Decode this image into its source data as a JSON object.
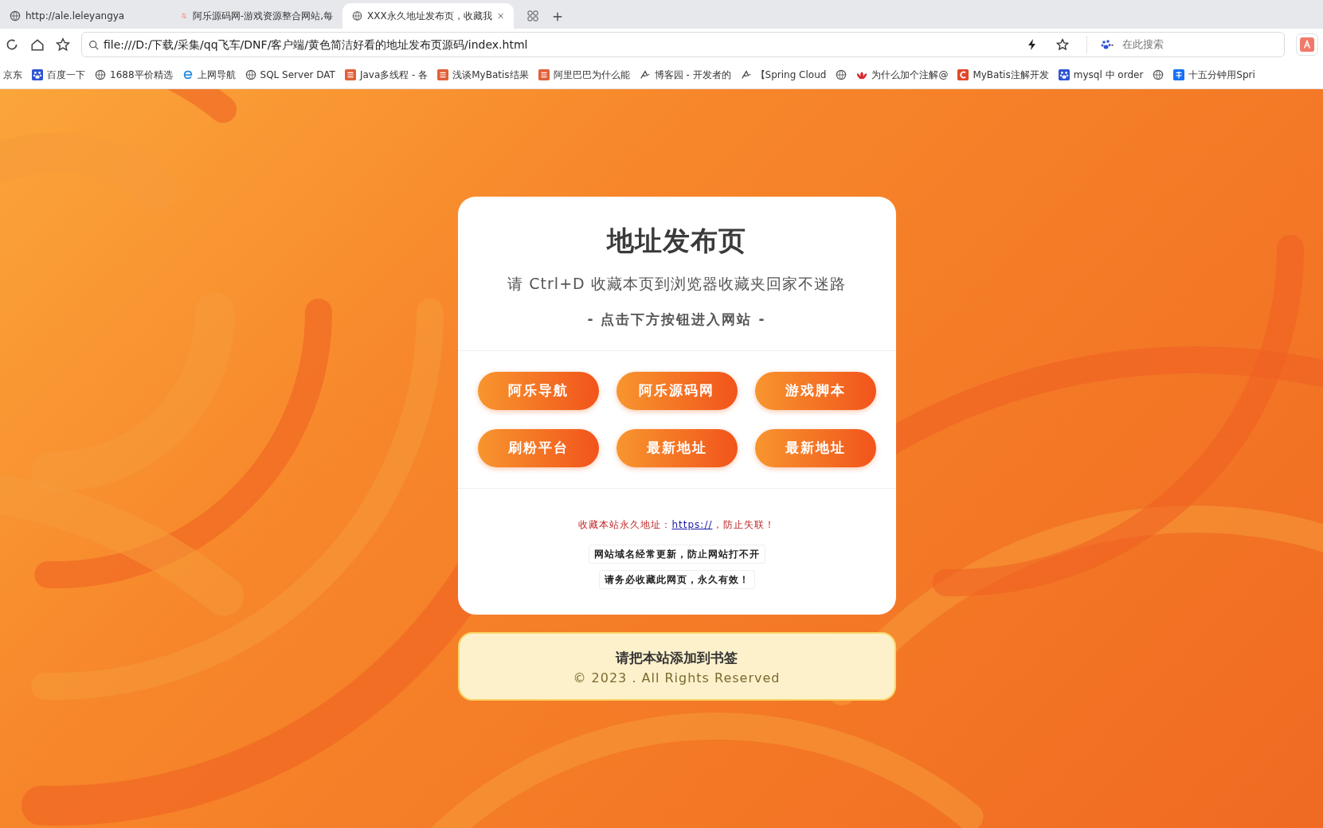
{
  "browser": {
    "tabs": [
      {
        "label": "http://ale.leleyangya",
        "selected": false,
        "kind": "globe"
      },
      {
        "label": "阿乐源码网-游戏资源整合网站,每",
        "selected": false,
        "kind": "le"
      },
      {
        "label": "XXX永久地址发布页，收藏我",
        "selected": true,
        "kind": "globe"
      }
    ],
    "address": "file:///D:/下载/采集/qq飞车/DNF/客户端/黄色简洁好看的地址发布页源码/index.html",
    "search_placeholder": "在此搜索",
    "bookmarks": [
      {
        "label": "京东",
        "kind": "none"
      },
      {
        "label": "百度一下",
        "kind": "paw"
      },
      {
        "label": "1688平价精选",
        "kind": "globe"
      },
      {
        "label": "上网导航",
        "kind": "e"
      },
      {
        "label": "SQL Server DAT",
        "kind": "globe"
      },
      {
        "label": "Java多线程 - 各",
        "kind": "jian"
      },
      {
        "label": "浅谈MyBatis结果",
        "kind": "jian"
      },
      {
        "label": "阿里巴巴为什么能",
        "kind": "jian"
      },
      {
        "label": "博客园 - 开发者的",
        "kind": "blog"
      },
      {
        "label": "【Spring Cloud",
        "kind": "blog"
      },
      {
        "kind": "globe"
      },
      {
        "label": "为什么加个注解@",
        "kind": "flower"
      },
      {
        "label": "MyBatis注解开发",
        "kind": "c"
      },
      {
        "label": "mysql 中 order",
        "kind": "paw"
      },
      {
        "kind": "globe"
      },
      {
        "label": "十五分钟用Spri",
        "kind": "zhi"
      }
    ]
  },
  "card": {
    "title": "地址发布页",
    "subtitle": "请 Ctrl+D 收藏本页到浏览器收藏夹回家不迷路",
    "tagline": "- 点击下方按钮进入网站 -",
    "buttons": [
      "阿乐导航",
      "阿乐源码网",
      "游戏脚本",
      "刷粉平台",
      "最新地址",
      "最新地址"
    ],
    "notice": "收藏本站永久地址：",
    "notice_link": "https://",
    "notice_end": "，防止失联！",
    "tips": [
      "网站域名经常更新，防止网站打不开",
      "请务必收藏此网页，永久有效！"
    ]
  },
  "footer": {
    "title": "请把本站添加到书签",
    "copyright": "© 2023 . All Rights Reserved"
  }
}
